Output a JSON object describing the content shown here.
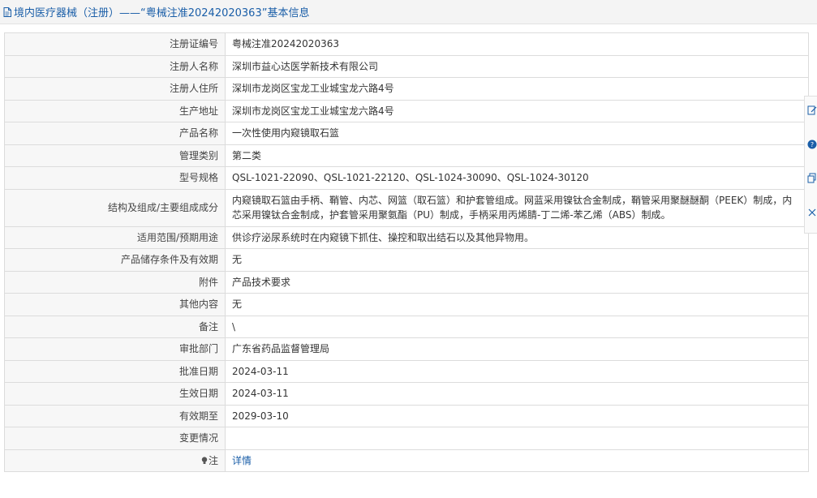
{
  "header": {
    "title": "境内医疗器械（注册）——“粤械注准20242020363”基本信息"
  },
  "rows": [
    {
      "label": "注册证编号",
      "value": "粤械注准20242020363"
    },
    {
      "label": "注册人名称",
      "value": "深圳市益心达医学新技术有限公司"
    },
    {
      "label": "注册人住所",
      "value": "深圳市龙岗区宝龙工业城宝龙六路4号"
    },
    {
      "label": "生产地址",
      "value": "深圳市龙岗区宝龙工业城宝龙六路4号"
    },
    {
      "label": "产品名称",
      "value": "一次性使用内窥镜取石篮"
    },
    {
      "label": "管理类别",
      "value": "第二类"
    },
    {
      "label": "型号规格",
      "value": "QSL-1021-22090、QSL-1021-22120、QSL-1024-30090、QSL-1024-30120"
    },
    {
      "label": "结构及组成/主要组成成分",
      "value": "内窥镜取石篮由手柄、鞘管、内芯、网篮（取石篮）和护套管组成。网蓝采用镍钛合金制成，鞘管采用聚醚醚酮（PEEK）制成，内芯采用镍钛合金制成，护套管采用聚氨酯（PU）制成，手柄采用丙烯腈-丁二烯-苯乙烯（ABS）制成。"
    },
    {
      "label": "适用范围/预期用途",
      "value": "供诊疗泌尿系统时在内窥镜下抓住、操控和取出结石以及其他异物用。"
    },
    {
      "label": "产品储存条件及有效期",
      "value": "无"
    },
    {
      "label": "附件",
      "value": "产品技术要求"
    },
    {
      "label": "其他内容",
      "value": "无"
    },
    {
      "label": "备注",
      "value": "\\"
    },
    {
      "label": "审批部门",
      "value": "广东省药品监督管理局"
    },
    {
      "label": "批准日期",
      "value": "2024-03-11"
    },
    {
      "label": "生效日期",
      "value": "2024-03-11"
    },
    {
      "label": "有效期至",
      "value": "2029-03-10"
    },
    {
      "label": "变更情况",
      "value": ""
    }
  ],
  "note_row": {
    "label": "注",
    "link": "详情"
  },
  "side_tools": [
    "edit-icon",
    "help-icon",
    "copy-icon",
    "close-icon"
  ],
  "colors": {
    "link": "#1a5ea8",
    "label_bg": "#f7f7f7",
    "border": "#dcdcdc"
  }
}
